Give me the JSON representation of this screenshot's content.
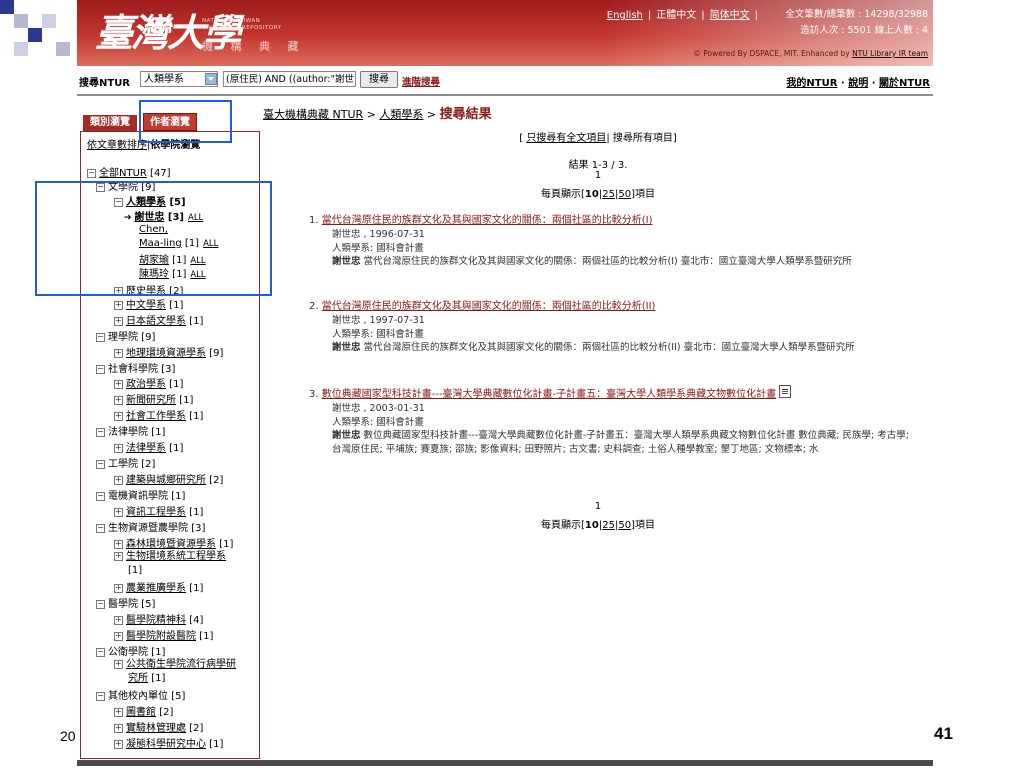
{
  "colors": {
    "header_red": "#c4372f",
    "highlight_blue": "#1f5fd6",
    "link_red": "#8a1a14"
  },
  "header": {
    "logo_cjk": "臺灣大學",
    "logo_en_1": "NATIONAL TAIWAN",
    "logo_en_2": "UNIVERSITY REPOSITORY",
    "logo_sub": "機 構 典 藏",
    "langs": [
      "English",
      "正體中文",
      "简体中文"
    ],
    "stats1": "全文筆數/總筆數 : 14298/32988",
    "stats2": "造訪人次 : 5501    線上人數 : 4",
    "powered": "© Powered By DSPACE, MIT. Enhanced by",
    "powered_link": "NTU Library IR team"
  },
  "searchbar": {
    "label": "搜尋NTUR",
    "scope": "人類學系",
    "query": "(原住民) AND ((author:\"謝世",
    "search_button": "搜尋",
    "advanced": "進階搜尋",
    "my_ntur": "我的NTUR",
    "help": "說明",
    "about": "關於NTUR",
    "dot": "·"
  },
  "left": {
    "tab_category": "類別瀏覽",
    "tab_author": "作者瀏覽",
    "sort_count": "依文章數排序",
    "sort_sep": "|",
    "sort_college": "依學院瀏覽",
    "tree": [
      {
        "label": "全部NTUR",
        "count": "[47]"
      },
      {
        "label": "文學院",
        "count": "[9]"
      },
      {
        "label": "人類學系",
        "count": "[5]"
      },
      {
        "label": "謝世忠",
        "count": "[3]",
        "all": "ALL"
      },
      {
        "label": "Chen,",
        "label2": "Maa-ling",
        "count": "[1]",
        "all": "ALL"
      },
      {
        "label": "胡家瑜",
        "count": "[1]",
        "all": "ALL"
      },
      {
        "label": "陳瑪玲",
        "count": "[1]",
        "all": "ALL"
      },
      {
        "label": "歷史學系",
        "count": "[2]"
      },
      {
        "label": "中文學系",
        "count": "[1]"
      },
      {
        "label": "日本語文學系",
        "count": "[1]"
      },
      {
        "label": "理學院",
        "count": "[9]"
      },
      {
        "label": "地理環境資源學系",
        "count": "[9]"
      },
      {
        "label": "社會科學院",
        "count": "[3]"
      },
      {
        "label": "政治學系",
        "count": "[1]"
      },
      {
        "label": "新聞研究所",
        "count": "[1]"
      },
      {
        "label": "社會工作學系",
        "count": "[1]"
      },
      {
        "label": "法律學院",
        "count": "[1]"
      },
      {
        "label": "法律學系",
        "count": "[1]"
      },
      {
        "label": "工學院",
        "count": "[2]"
      },
      {
        "label": "建築與城鄉研究所",
        "count": "[2]"
      },
      {
        "label": "電機資訊學院",
        "count": "[1]"
      },
      {
        "label": "資訊工程學系",
        "count": "[1]"
      },
      {
        "label": "生物資源暨農學院",
        "count": "[3]"
      },
      {
        "label": "森林環境暨資源學系",
        "count": "[1]"
      },
      {
        "label": "生物環境系統工程學系",
        "count": "[1]"
      },
      {
        "label": "農業推廣學系",
        "count": "[1]"
      },
      {
        "label": "醫學院",
        "count": "[5]"
      },
      {
        "label": "醫學院精神科",
        "count": "[4]"
      },
      {
        "label": "醫學院附設醫院",
        "count": "[1]"
      },
      {
        "label": "公衛學院",
        "count": "[1]"
      },
      {
        "label": "公共衛生學院流行病學研",
        "label2": "究所",
        "count": "[1]"
      },
      {
        "label": "其他校內單位",
        "count": "[5]"
      },
      {
        "label": "圖書館",
        "count": "[2]"
      },
      {
        "label": "實驗林管理處",
        "count": "[2]"
      },
      {
        "label": "凝態科學研究中心",
        "count": "[1]"
      }
    ]
  },
  "main": {
    "breadcrumb_home": "臺大機構典藏 NTUR",
    "breadcrumb_dept": "人類學系",
    "breadcrumb_sep": ">",
    "breadcrumb_current": "搜尋結果",
    "only_fulltext_left": "[",
    "only_fulltext": "只搜尋有全文項目",
    "only_fulltext_rest": "| 搜尋所有項目]",
    "results_range": "結果 1-3 / 3.",
    "page_number": "1",
    "per_page_prefix": "每頁顯示[",
    "per_page_10": "10",
    "per_page_25": "25",
    "per_page_50": "50",
    "per_page_suffix": "]項目",
    "results": [
      {
        "num": "1.",
        "title": "當代台灣原住民的族群文化及其與國家文化的關係：兩個社區的比較分析(I)",
        "author_date": "謝世忠 ,   1996-07-31",
        "source": "人類學系: 國科會計畫",
        "abstract_author": "謝世忠",
        "abstract": "當代台灣原住民的族群文化及其與國家文化的關係：兩個社區的比較分析(I) 臺北市：國立臺灣大學人類學系暨研究所"
      },
      {
        "num": "2.",
        "title": "當代台灣原住民的族群文化及其與國家文化的關係：兩個社區的比較分析(II)",
        "author_date": "謝世忠 ,   1997-07-31",
        "source": "人類學系: 國科會計畫",
        "abstract_author": "謝世忠",
        "abstract": "當代台灣原住民的族群文化及其與國家文化的關係：兩個社區的比較分析(II) 臺北市：國立臺灣大學人類學系暨研究所"
      },
      {
        "num": "3.",
        "title": "數位典藏國家型科技計畫---臺灣大學典藏數位化計畫-子計畫五：臺灣大學人類學系典藏文物數位化計畫",
        "author_date": "謝世忠 ,   2003-01-31",
        "source": "人類學系: 國科會計畫",
        "abstract_author": "謝世忠",
        "abstract": "數位典藏國家型科技計畫---臺灣大學典藏數位化計畫-子計畫五：臺灣大學人類學系典藏文物數位化計畫 數位典藏; 民族學; 考古學; 台灣原住民; 平埔族; 賽夏族; 邵族; 影像資料; 田野照片; 古文書; 史料調查; 土俗人種學教室; 墾丁地區; 文物標本; 水"
      }
    ]
  },
  "slide": {
    "year_fragment": "20",
    "page_number": "41"
  }
}
